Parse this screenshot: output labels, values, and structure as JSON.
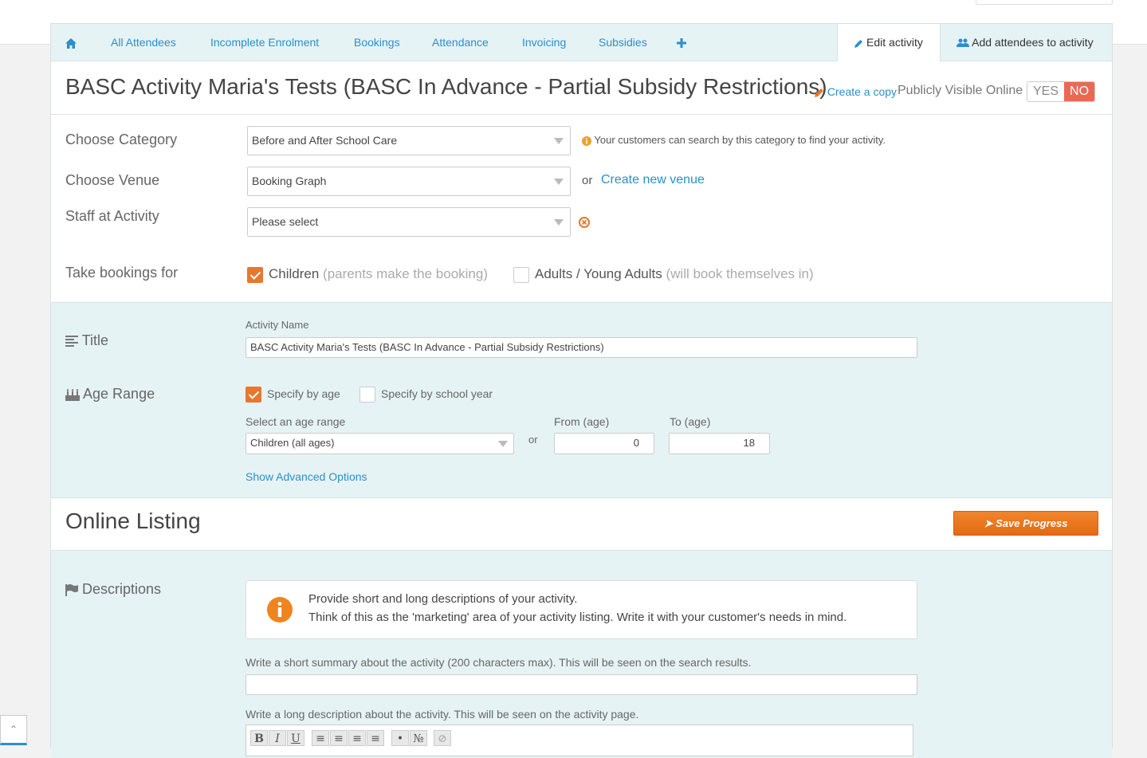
{
  "nav": {
    "items": [
      "All Attendees",
      "Incomplete Enrolment",
      "Bookings",
      "Attendance",
      "Invoicing",
      "Subsidies"
    ],
    "edit_tab": "Edit activity",
    "add_tab": "Add attendees to activity"
  },
  "header": {
    "title": "BASC Activity Maria's Tests (BASC In Advance - Partial Subsidy Restrictions)",
    "create_copy": "Create a copy",
    "publicly_visible": "Publicly Visible Online",
    "yes": "YES",
    "no": "NO",
    "visible_value": "NO"
  },
  "form": {
    "category_label": "Choose Category",
    "category_value": "Before and After School Care",
    "category_hint": "Your customers can search by this category to find your activity.",
    "venue_label": "Choose Venue",
    "venue_value": "Booking Graph",
    "venue_or": "or",
    "venue_link": "Create new venue",
    "staff_label": "Staff at Activity",
    "staff_value": "Please select",
    "bookings_label": "Take bookings for",
    "children_label": "Children",
    "children_note": "(parents make the booking)",
    "children_checked": true,
    "adults_label": "Adults / Young Adults",
    "adults_note": "(will book themselves in)",
    "adults_checked": false
  },
  "title_section": {
    "label": "Title",
    "activity_name_label": "Activity Name",
    "activity_name_value": "BASC Activity Maria's Tests (BASC In Advance - Partial Subsidy Restrictions)"
  },
  "age_section": {
    "label": "Age Range",
    "by_age": "Specify by age",
    "by_age_checked": true,
    "by_school_year": "Specify by school year",
    "by_school_year_checked": false,
    "select_label": "Select an age range",
    "select_value": "Children (all ages)",
    "or": "or",
    "from_label": "From (age)",
    "from_value": "0",
    "to_label": "To (age)",
    "to_value": "18",
    "advanced_link": "Show Advanced Options"
  },
  "online_listing": {
    "title": "Online Listing",
    "save_button": "Save Progress",
    "descriptions_label": "Descriptions",
    "info_line1": "Provide short and long descriptions of your activity.",
    "info_line2": "Think of this as the 'marketing' area of your activity listing. Write it with your customer's needs in mind.",
    "short_label": "Write a short summary about the activity (200 characters max). This will be seen on the search results.",
    "long_label": "Write a long description about the activity. This will be seen on the activity page.",
    "toolbar": [
      "B",
      "I",
      "U"
    ]
  },
  "colors": {
    "accent_link": "#2a8fcf",
    "orange": "#e8772e",
    "no_red": "#e86a55",
    "teal_bg": "#e6f3f4"
  }
}
